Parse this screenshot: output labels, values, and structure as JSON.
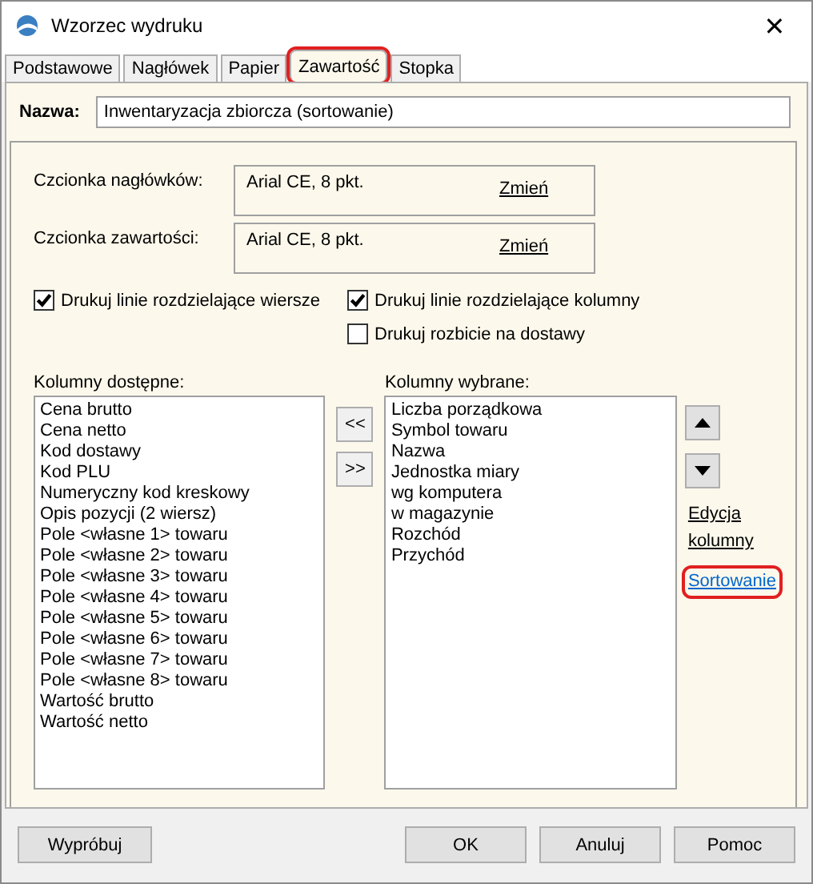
{
  "window": {
    "title": "Wzorzec wydruku",
    "close": "✕"
  },
  "tabs": [
    {
      "label": "Podstawowe",
      "selected": false,
      "highlighted": false
    },
    {
      "label": "Nagłówek",
      "selected": false,
      "highlighted": false
    },
    {
      "label": "Papier",
      "selected": false,
      "highlighted": false
    },
    {
      "label": "Zawartość",
      "selected": true,
      "highlighted": true
    },
    {
      "label": "Stopka",
      "selected": false,
      "highlighted": false
    }
  ],
  "name_field": {
    "label": "Nazwa:",
    "value": "Inwentaryzacja zbiorcza (sortowanie)"
  },
  "fonts": [
    {
      "label": "Czcionka nagłówków:",
      "value": "Arial CE, 8 pkt.",
      "link": "Zmień"
    },
    {
      "label": "Czcionka zawartości:",
      "value": "Arial CE, 8 pkt.",
      "link": "Zmień"
    }
  ],
  "checkboxes": [
    {
      "label": "Drukuj linie rozdzielające wiersze",
      "checked": true
    },
    {
      "label": "Drukuj linie rozdzielające kolumny",
      "checked": true
    },
    {
      "label": "Drukuj rozbicie na dostawy",
      "checked": false
    }
  ],
  "available": {
    "label": "Kolumny dostępne:",
    "items": [
      "Cena brutto",
      "Cena netto",
      "Kod dostawy",
      "Kod PLU",
      "Numeryczny kod kreskowy",
      "Opis pozycji (2 wiersz)",
      "Pole <własne 1> towaru",
      "Pole <własne 2> towaru",
      "Pole <własne 3> towaru",
      "Pole <własne 4> towaru",
      "Pole <własne 5> towaru",
      "Pole <własne 6> towaru",
      "Pole <własne 7> towaru",
      "Pole <własne 8> towaru",
      "Wartość brutto",
      "Wartość netto"
    ]
  },
  "move_buttons": [
    "<<",
    ">>"
  ],
  "chosen": {
    "label": "Kolumny wybrane:",
    "items": [
      "Liczba porządkowa",
      "Symbol towaru",
      "Nazwa",
      "Jednostka miary",
      "wg komputera",
      "w magazynie",
      "Rozchód",
      "Przychód"
    ]
  },
  "side_links": [
    {
      "label": "Edycja kolumny",
      "highlighted": false
    },
    {
      "label": "Sortowanie",
      "highlighted": true
    }
  ],
  "buttons": [
    {
      "label": "Wypróbuj",
      "kind": "left"
    },
    {
      "label": "OK",
      "kind": "right"
    },
    {
      "label": "Anuluj",
      "kind": "right"
    },
    {
      "label": "Pomoc",
      "kind": "right"
    }
  ]
}
